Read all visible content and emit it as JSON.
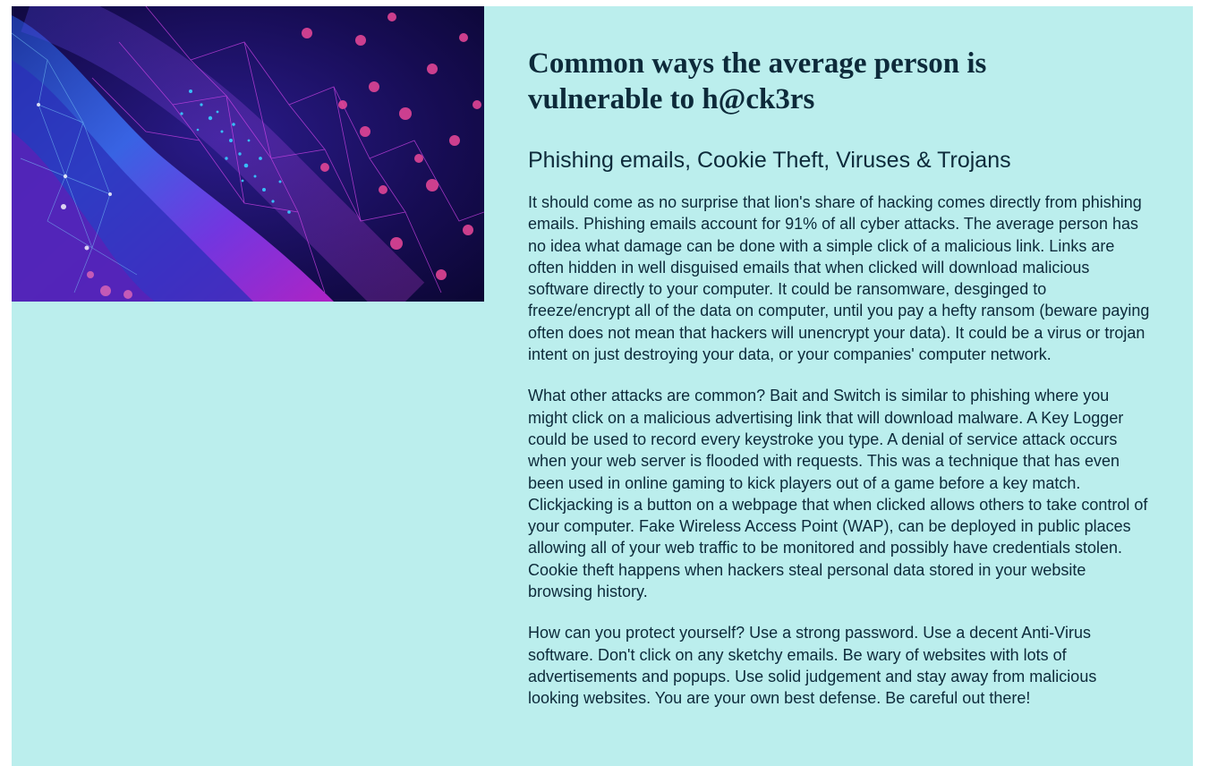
{
  "hero_image": {
    "icon": "abstract-cyber-network-image",
    "colors": [
      "#0a0f4a",
      "#3b6cf0",
      "#c026d3",
      "#38bdf8",
      "#ec4899"
    ]
  },
  "article": {
    "headline": "Common ways the average person is vulnerable to h@ck3rs",
    "subheading": "Phishing emails, Cookie Theft, Viruses & Trojans",
    "paragraphs": [
      "It should come as no surprise that lion's share of hacking comes directly from phishing emails. Phishing emails account for 91% of all cyber attacks. The average person has no idea what damage can be done with a simple click of a malicious link. Links are often hidden in well disguised emails that when clicked will download malicious software directly to your computer. It could be ransomware, desginged to freeze/encrypt all of the data on computer, until you pay a hefty ransom (beware paying often does not mean that hackers will unencrypt your data). It could be a virus or trojan intent on just destroying your data, or your companies' computer network.",
      "What other attacks are common? Bait and Switch is similar to phishing where you might click on a malicious advertising link that will download malware. A Key Logger could be used to record every keystroke you type. A denial of service attack occurs when your web server is flooded with requests. This was a technique that has even been used in online gaming to kick players out of a game before a key match. Clickjacking is a button on a webpage that when clicked allows others to take control of your computer. Fake Wireless Access Point (WAP), can be deployed in public places allowing all of your web traffic to be monitored and possibly have credentials stolen. Cookie theft happens when hackers steal personal data stored in your website browsing history.",
      "How can you protect yourself? Use a strong password. Use a decent Anti-Virus software. Don't click on any sketchy emails. Be wary of websites with lots of advertisements and popups. Use solid judgement and stay away from malicious looking websites. You are your own best defense. Be careful out there!"
    ]
  },
  "colors": {
    "card_background": "#bbeeed",
    "text": "#0d2a3a"
  }
}
